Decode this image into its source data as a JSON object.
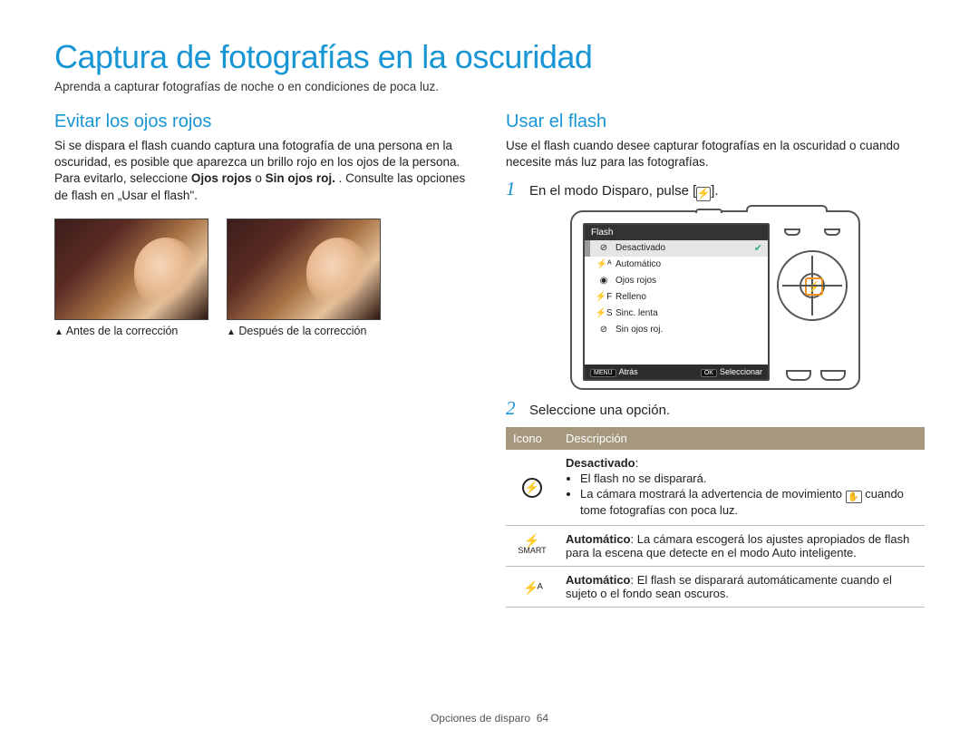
{
  "page_title": "Captura de fotografías en la oscuridad",
  "page_subtitle": "Aprenda a capturar fotografías de noche o en condiciones de poca luz.",
  "left": {
    "heading": "Evitar los ojos rojos",
    "p1a": "Si se dispara el flash cuando captura una fotografía de una persona en la oscuridad, es posible que aparezca un brillo rojo en los ojos de la persona. Para evitarlo, seleccione ",
    "p1b": "Ojos rojos",
    "p1c": " o ",
    "p1d": "Sin ojos roj.",
    "p1e": ". Consulte las opciones de flash en „Usar el flash\".",
    "cap1": "Antes de la corrección",
    "cap2": "Después de la corrección"
  },
  "right": {
    "heading": "Usar el flash",
    "intro": "Use el flash cuando desee capturar fotografías en la oscuridad o cuando necesite más luz para las fotografías.",
    "step1": "En el modo Disparo, pulse [",
    "step1_end": "].",
    "step2": "Seleccione una opción.",
    "lcd": {
      "title": "Flash",
      "items": [
        "Desactivado",
        "Automático",
        "Ojos rojos",
        "Relleno",
        "Sinc. lenta",
        "Sin ojos roj."
      ],
      "footer_left_btn": "MENU",
      "footer_left": "Atrás",
      "footer_right_btn": "OK",
      "footer_right": "Seleccionar"
    },
    "table": {
      "h1": "Icono",
      "h2": "Descripción",
      "row1_title": "Desactivado",
      "row1_b1": "El flash no se disparará.",
      "row1_b2a": "La cámara mostrará la advertencia de movimiento ",
      "row1_b2b": " cuando tome fotografías con poca luz.",
      "row2_title": "Automático",
      "row2_text": ": La cámara escogerá los ajustes apropiados de flash para la escena que detecte en el modo Auto inteligente.",
      "row3_title": "Automático",
      "row3_text": ": El flash se disparará automáticamente cuando el sujeto o el fondo sean oscuros."
    }
  },
  "footer_section": "Opciones de disparo",
  "footer_page": "64"
}
